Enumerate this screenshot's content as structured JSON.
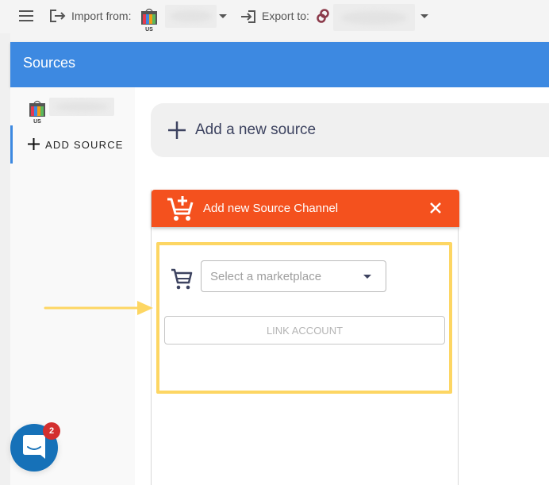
{
  "toolbar": {
    "menu_icon": "hamburger-menu-icon",
    "import_icon": "import-icon",
    "import_label": "Import from:",
    "import_store_badge": "US",
    "export_icon": "export-icon",
    "export_label": "Export to:"
  },
  "header": {
    "title": "Sources"
  },
  "sidebar": {
    "sources": [
      {
        "badge": "US"
      }
    ],
    "add_source_label": "ADD SOURCE"
  },
  "main": {
    "add_new_source_label": "Add a new source",
    "panel": {
      "title": "Add new Source Channel",
      "marketplace_placeholder": "Select a marketplace",
      "link_account_label": "LINK ACCOUNT"
    }
  },
  "chat": {
    "unread_count": "2"
  },
  "colors": {
    "header_blue": "#3d89e1",
    "panel_orange": "#f4511e",
    "highlight_yellow": "#fdd663",
    "chat_blue": "#1671b8",
    "badge_red": "#d32f2f"
  }
}
